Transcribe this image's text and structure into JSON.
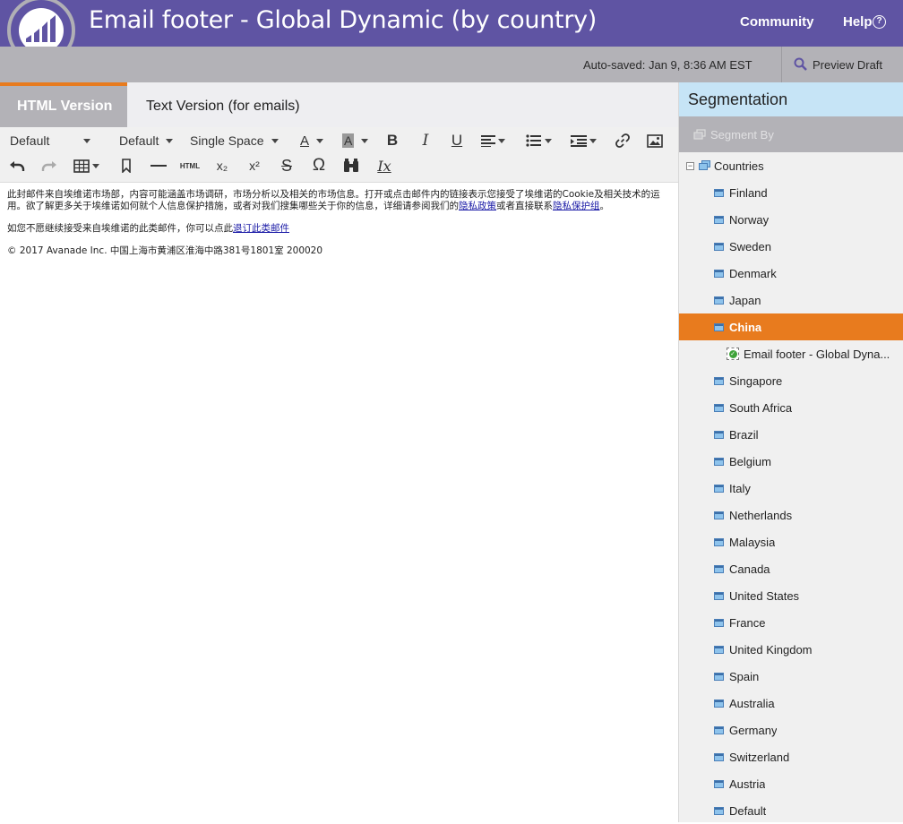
{
  "header": {
    "title": "Email footer - Global Dynamic (by country)",
    "community": "Community",
    "help": "Help",
    "help_icon_glyph": "?",
    "brand_color": "#5f54a3"
  },
  "status": {
    "autosaved": "Auto-saved: Jan 9, 8:36 AM EST",
    "preview": "Preview Draft"
  },
  "tabs": [
    {
      "label": "HTML Version",
      "active": true
    },
    {
      "label": "Text Version (for emails)",
      "active": false
    }
  ],
  "toolbar": {
    "font_family": "Default",
    "font_size": "Default",
    "line_spacing": "Single Space",
    "row1_icons": [
      "font-color-icon",
      "highlight-color-icon",
      "bold-icon",
      "italic-icon",
      "underline-icon",
      "align-icon",
      "list-icon",
      "indent-icon",
      "link-icon",
      "image-icon"
    ],
    "row2_icons": [
      "undo-icon",
      "redo-icon",
      "table-icon",
      "bookmark-icon",
      "horizontal-rule-icon",
      "html-icon",
      "subscript-icon",
      "superscript-icon",
      "strikethrough-icon",
      "special-char-icon",
      "find-icon",
      "clear-format-icon"
    ],
    "glyphs": {
      "font_color": "A",
      "highlight": "A",
      "bold": "B",
      "italic": "I",
      "underline": "U",
      "html": "HTML",
      "subscript": "x₂",
      "superscript": "x²",
      "strike": "S",
      "omega": "Ω",
      "clear_format": "Ix"
    }
  },
  "content": {
    "para1_text": "此封邮件来自埃维诺市场部，内容可能涵盖市场调研，市场分析以及相关的市场信息。打开或点击邮件内的链接表示您接受了埃维诺的Cookie及相关技术的运用。欲了解更多关于埃维诺如何就个人信息保护措施，或者对我们搜集哪些关于你的信息，详细请参阅我们的",
    "privacy_policy_link": "隐私政策",
    "para1_mid": "或者直接联系",
    "privacy_team_link": "隐私保护组",
    "para1_end": "。",
    "para2_text": "如您不愿继续接受来自埃维诺的此类邮件，你可以点此",
    "unsubscribe_link": "退订此类邮件",
    "para3_text": "© 2017 Avanade Inc. 中国上海市黄浦区淮海中路381号1801室 200020"
  },
  "sidebar": {
    "title": "Segmentation",
    "segment_by": "Segment By",
    "root": "Countries",
    "root_expander": "−",
    "email_check_glyph": "✓",
    "segments": [
      {
        "label": "Finland",
        "selected": false
      },
      {
        "label": "Norway",
        "selected": false
      },
      {
        "label": "Sweden",
        "selected": false
      },
      {
        "label": "Denmark",
        "selected": false
      },
      {
        "label": "Japan",
        "selected": false
      },
      {
        "label": "China",
        "selected": true
      },
      {
        "label": "Email footer - Global Dyna...",
        "selected": false,
        "child": true
      },
      {
        "label": "Singapore",
        "selected": false
      },
      {
        "label": "South Africa",
        "selected": false
      },
      {
        "label": "Brazil",
        "selected": false
      },
      {
        "label": "Belgium",
        "selected": false
      },
      {
        "label": "Italy",
        "selected": false
      },
      {
        "label": "Netherlands",
        "selected": false
      },
      {
        "label": "Malaysia",
        "selected": false
      },
      {
        "label": "Canada",
        "selected": false
      },
      {
        "label": "United States",
        "selected": false
      },
      {
        "label": "France",
        "selected": false
      },
      {
        "label": "United Kingdom",
        "selected": false
      },
      {
        "label": "Spain",
        "selected": false
      },
      {
        "label": "Australia",
        "selected": false
      },
      {
        "label": "Germany",
        "selected": false
      },
      {
        "label": "Switzerland",
        "selected": false
      },
      {
        "label": "Austria",
        "selected": false
      },
      {
        "label": "Default",
        "selected": false
      }
    ],
    "selected_color": "#e87b1e"
  }
}
